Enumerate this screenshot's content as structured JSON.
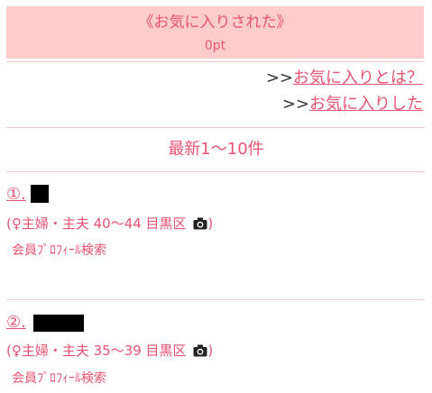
{
  "header": {
    "title": "《お気に入りされた》",
    "points": "0pt"
  },
  "links": {
    "prefix": ">>",
    "about_favorites": "お気に入りとは？",
    "favorited": "お気に入りした"
  },
  "list_heading": "最新1～10件",
  "members": [
    {
      "number": "①.",
      "info_prefix": "(♀主婦・主夫 40～44 目黒区",
      "info_suffix": ")",
      "profile_search": "会員ﾌﾟﾛﾌｨｰﾙ検索"
    },
    {
      "number": "②.",
      "info_prefix": "(♀主婦・主夫 35～39 目黒区",
      "info_suffix": ")",
      "profile_search": "会員ﾌﾟﾛﾌｨｰﾙ検索"
    }
  ]
}
